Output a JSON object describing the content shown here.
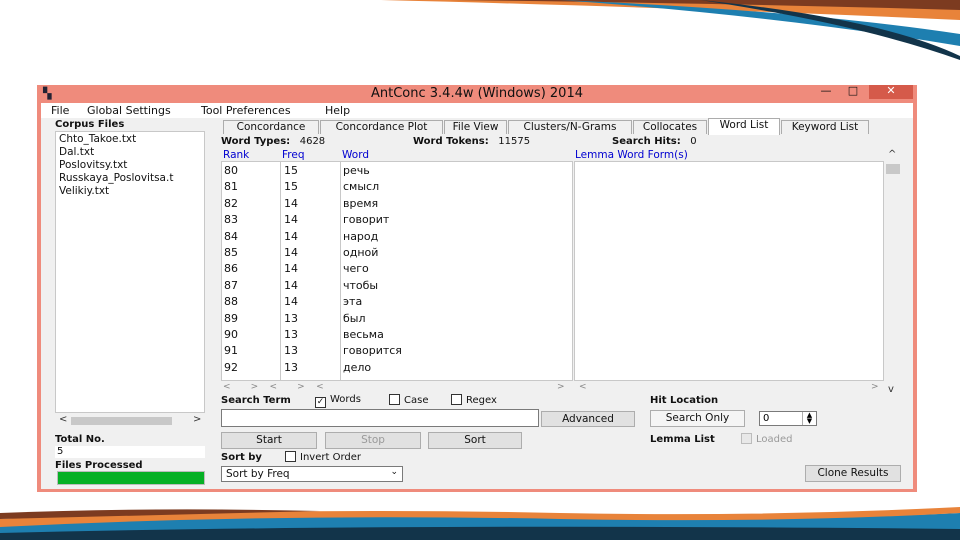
{
  "window": {
    "title": "AntConc 3.4.4w (Windows) 2014",
    "icon": "antconc-app-icon",
    "minimize": "—",
    "maximize": "□",
    "close": "✕"
  },
  "menu": [
    "File",
    "Global Settings",
    "Tool Preferences",
    "Help"
  ],
  "corpus": {
    "label": "Corpus Files",
    "files": [
      "Chto_Takoe.txt",
      "Dal.txt",
      "Poslovitsy.txt",
      "Russkaya_Poslovitsa.t",
      "Velikiy.txt"
    ],
    "total_label": "Total No.",
    "total_value": "5",
    "processed_label": "Files Processed",
    "progress": 1.0
  },
  "tabs": [
    "Concordance",
    "Concordance Plot",
    "File View",
    "Clusters/N-Grams",
    "Collocates",
    "Word List",
    "Keyword List"
  ],
  "active_tab": "Word List",
  "stats": {
    "types_label": "Word Types:",
    "types_value": "4628",
    "tokens_label": "Word Tokens:",
    "tokens_value": "11575",
    "hits_label": "Search Hits:",
    "hits_value": "0"
  },
  "columns": {
    "rank": "Rank",
    "freq": "Freq",
    "word": "Word",
    "lemma": "Lemma Word Form(s)"
  },
  "rows": [
    {
      "rank": "80",
      "freq": "15",
      "word": "речь"
    },
    {
      "rank": "81",
      "freq": "15",
      "word": "смысл"
    },
    {
      "rank": "82",
      "freq": "14",
      "word": "время"
    },
    {
      "rank": "83",
      "freq": "14",
      "word": "говорит"
    },
    {
      "rank": "84",
      "freq": "14",
      "word": "народ"
    },
    {
      "rank": "85",
      "freq": "14",
      "word": "одной"
    },
    {
      "rank": "86",
      "freq": "14",
      "word": "чего"
    },
    {
      "rank": "87",
      "freq": "14",
      "word": "чтобы"
    },
    {
      "rank": "88",
      "freq": "14",
      "word": "эта"
    },
    {
      "rank": "89",
      "freq": "13",
      "word": "был"
    },
    {
      "rank": "90",
      "freq": "13",
      "word": "весьма"
    },
    {
      "rank": "91",
      "freq": "13",
      "word": "говорится"
    },
    {
      "rank": "92",
      "freq": "13",
      "word": "дело"
    }
  ],
  "search": {
    "term_label": "Search Term",
    "words_label": "Words",
    "words_checked": true,
    "case_label": "Case",
    "case_checked": false,
    "regex_label": "Regex",
    "regex_checked": false,
    "value": "",
    "advanced_label": "Advanced",
    "hit_location_label": "Hit Location",
    "search_only_label": "Search Only",
    "hit_value": "0"
  },
  "actions": {
    "start": "Start",
    "stop": "Stop",
    "sort": "Sort",
    "lemma_list_label": "Lemma List",
    "loaded_label": "Loaded",
    "sort_by_label": "Sort by",
    "invert_label": "Invert Order",
    "sort_select": "Sort by Freq",
    "clone_label": "Clone Results"
  },
  "colors": {
    "window_frame": "#ef8b7c",
    "header_blue": "#0000d0",
    "progress_green": "#06b025",
    "deco_blue": "#1e7fb0",
    "deco_orange": "#e8833a"
  }
}
